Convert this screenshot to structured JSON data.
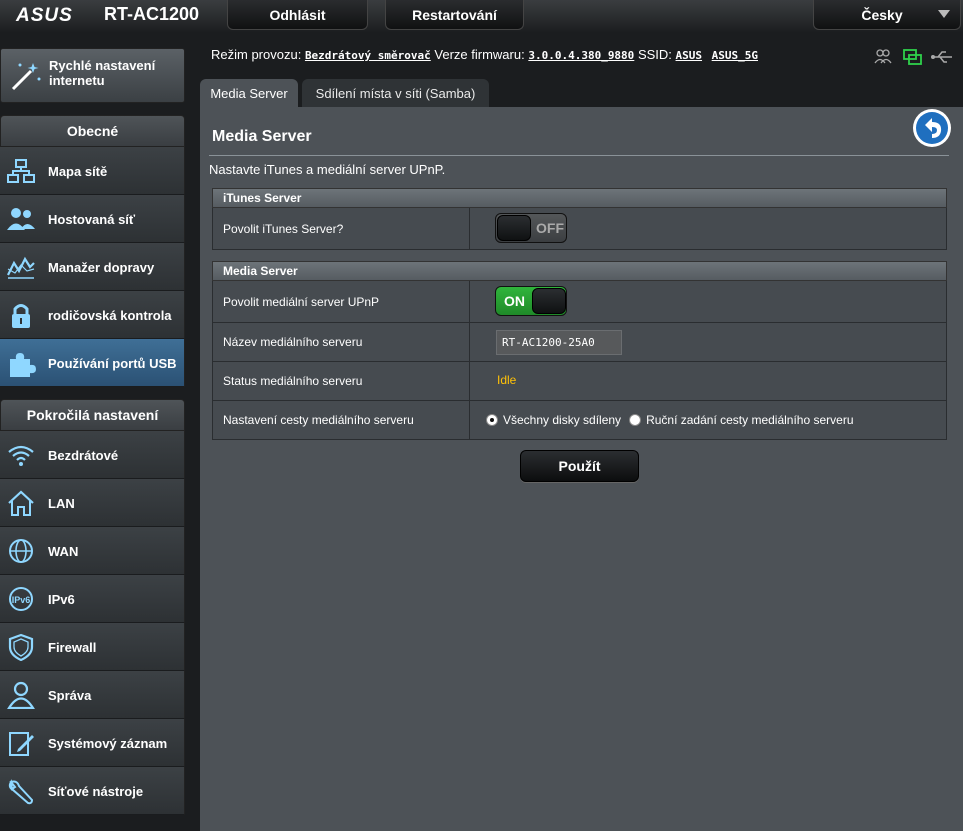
{
  "header": {
    "brand": "ASUS",
    "model": "RT-AC1200",
    "logout_label": "Odhlásit",
    "restart_label": "Restartování",
    "language": "Česky"
  },
  "status": {
    "mode_label": "Režim provozu:",
    "mode_value": "Bezdrátový směrovač",
    "firmware_label": "Verze firmwaru:",
    "firmware_value": "3.0.0.4.380_9880",
    "ssid_label": "SSID:",
    "ssid_values": [
      "ASUS",
      "ASUS_5G"
    ]
  },
  "sidebar": {
    "quick_setup": "Rychlé nastavení internetu",
    "general_header": "Obecné",
    "general_items": [
      {
        "label": "Mapa sítě",
        "icon": "network-map-icon"
      },
      {
        "label": "Hostovaná síť",
        "icon": "guest-network-icon"
      },
      {
        "label": "Manažer dopravy",
        "icon": "traffic-manager-icon"
      },
      {
        "label": "rodičovská kontrola",
        "icon": "lock-icon"
      },
      {
        "label": "Používání portů USB",
        "icon": "puzzle-icon"
      }
    ],
    "advanced_header": "Pokročilá nastavení",
    "advanced_items": [
      {
        "label": "Bezdrátové",
        "icon": "wifi-icon"
      },
      {
        "label": "LAN",
        "icon": "home-icon"
      },
      {
        "label": "WAN",
        "icon": "globe-icon"
      },
      {
        "label": "IPv6",
        "icon": "ipv6-icon"
      },
      {
        "label": "Firewall",
        "icon": "shield-icon"
      },
      {
        "label": "Správa",
        "icon": "user-icon"
      },
      {
        "label": "Systémový záznam",
        "icon": "log-icon"
      },
      {
        "label": "Síťové nástroje",
        "icon": "tools-icon"
      }
    ]
  },
  "tabs": [
    {
      "label": "Media Server",
      "active": true
    },
    {
      "label": "Sdílení místa v síti (Samba)",
      "active": false
    }
  ],
  "page": {
    "title": "Media Server",
    "description": "Nastavte iTunes a mediální server UPnP."
  },
  "itunes": {
    "header": "iTunes Server",
    "enable_label": "Povolit iTunes Server?",
    "enable_state": "OFF"
  },
  "media": {
    "header": "Media Server",
    "enable_label": "Povolit mediální server UPnP",
    "enable_state": "ON",
    "name_label": "Název mediálního serveru",
    "name_value": "RT-AC1200-25A0",
    "status_label": "Status mediálního serveru",
    "status_value": "Idle",
    "path_label": "Nastavení cesty mediálního serveru",
    "path_option_all": "Všechny disky sdíleny",
    "path_option_manual": "Ruční zadání cesty mediálního serveru",
    "path_selected": "all"
  },
  "apply_label": "Použít",
  "colors": {
    "accent_on": "#1f9a2a",
    "status_idle": "#ffc107",
    "active_menu": "#3f6f96"
  }
}
